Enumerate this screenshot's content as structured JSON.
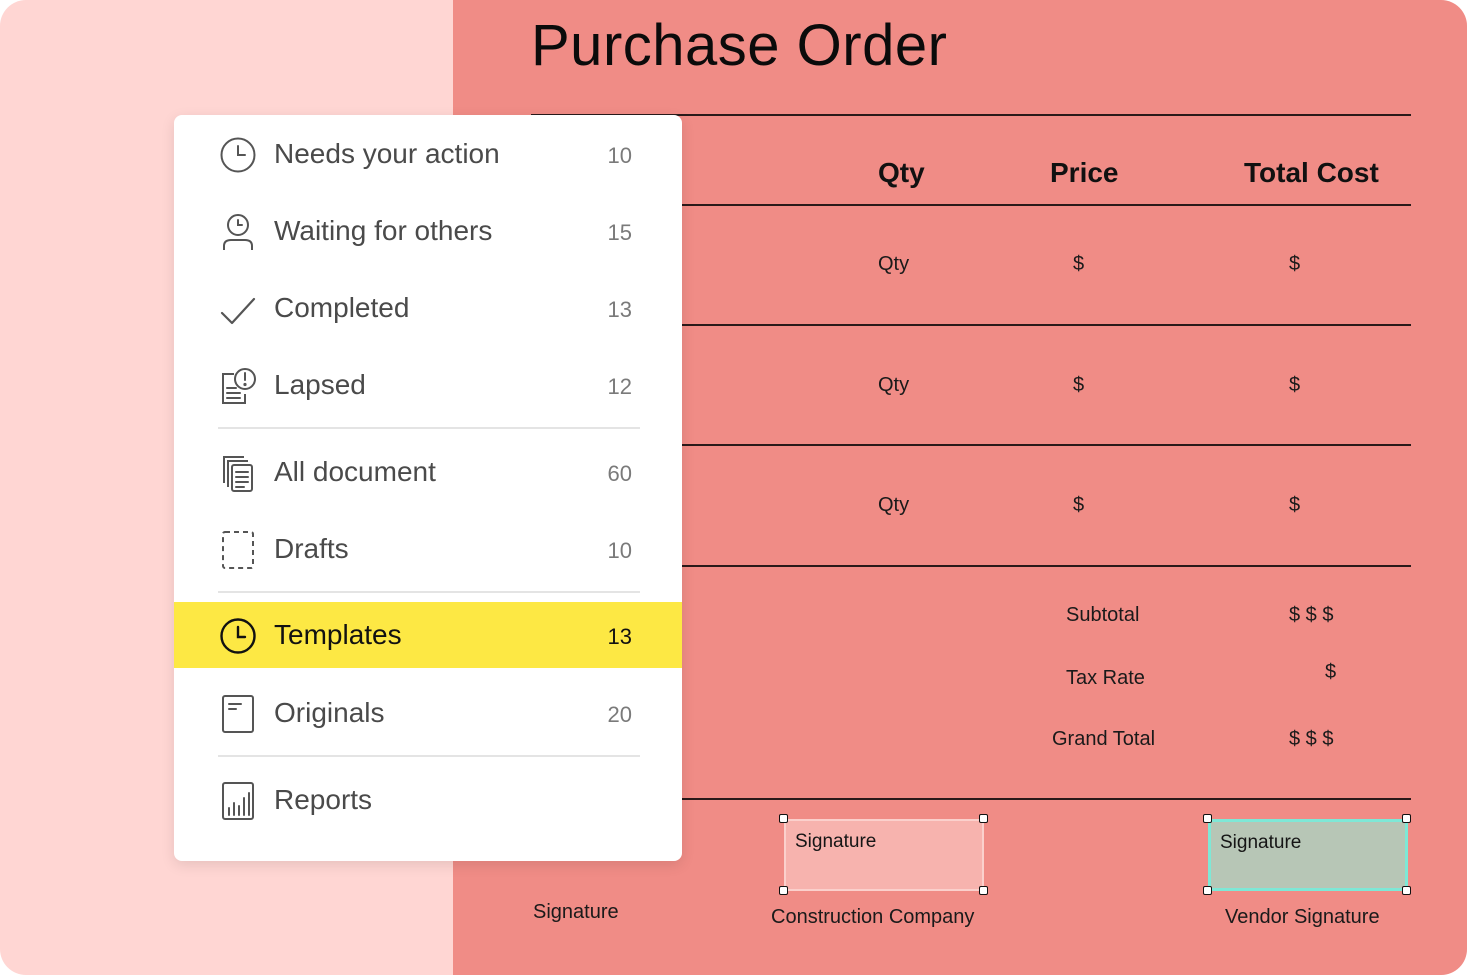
{
  "document": {
    "title": "Purchase Order",
    "headers": {
      "qty": "Qty",
      "price": "Price",
      "total": "Total Cost"
    },
    "rows": [
      {
        "qty": "Qty",
        "price": "$",
        "total": "$"
      },
      {
        "qty": "Qty",
        "price": "$",
        "total": "$"
      },
      {
        "qty": "Qty",
        "price": "$",
        "total": "$"
      }
    ],
    "summary": {
      "subtotal_label": "Subtotal",
      "subtotal_value": "$ $ $",
      "tax_label": "Tax Rate",
      "tax_value": "$",
      "grand_label": "Grand Total",
      "grand_value": "$ $ $"
    },
    "signatures": {
      "left_caption": "Signature",
      "company_box_label": "Signature",
      "company_caption": "Construction Company",
      "vendor_box_label": "Signature",
      "vendor_caption": "Vendor Signature"
    }
  },
  "menu": {
    "items": [
      {
        "label": "Needs your action",
        "count": "10",
        "icon": "clock-icon"
      },
      {
        "label": "Waiting for others",
        "count": "15",
        "icon": "person-clock-icon"
      },
      {
        "label": "Completed",
        "count": "13",
        "icon": "checkmark-icon"
      },
      {
        "label": "Lapsed",
        "count": "12",
        "icon": "document-alert-icon"
      },
      {
        "label": "All document",
        "count": "60",
        "icon": "documents-stack-icon"
      },
      {
        "label": "Drafts",
        "count": "10",
        "icon": "dashed-page-icon"
      },
      {
        "label": "Templates",
        "count": "13",
        "icon": "clock-icon"
      },
      {
        "label": "Originals",
        "count": "20",
        "icon": "page-icon"
      },
      {
        "label": "Reports",
        "count": "",
        "icon": "bar-chart-icon"
      }
    ],
    "active_item": "Templates"
  },
  "colors": {
    "page_background": "#ffd6d3",
    "document_background": "#f08c86",
    "active_highlight": "#fde844",
    "company_signature_fill": "#f7b3ae",
    "vendor_signature_fill": "#b7c6b6",
    "vendor_signature_border": "#7ee8d6"
  }
}
